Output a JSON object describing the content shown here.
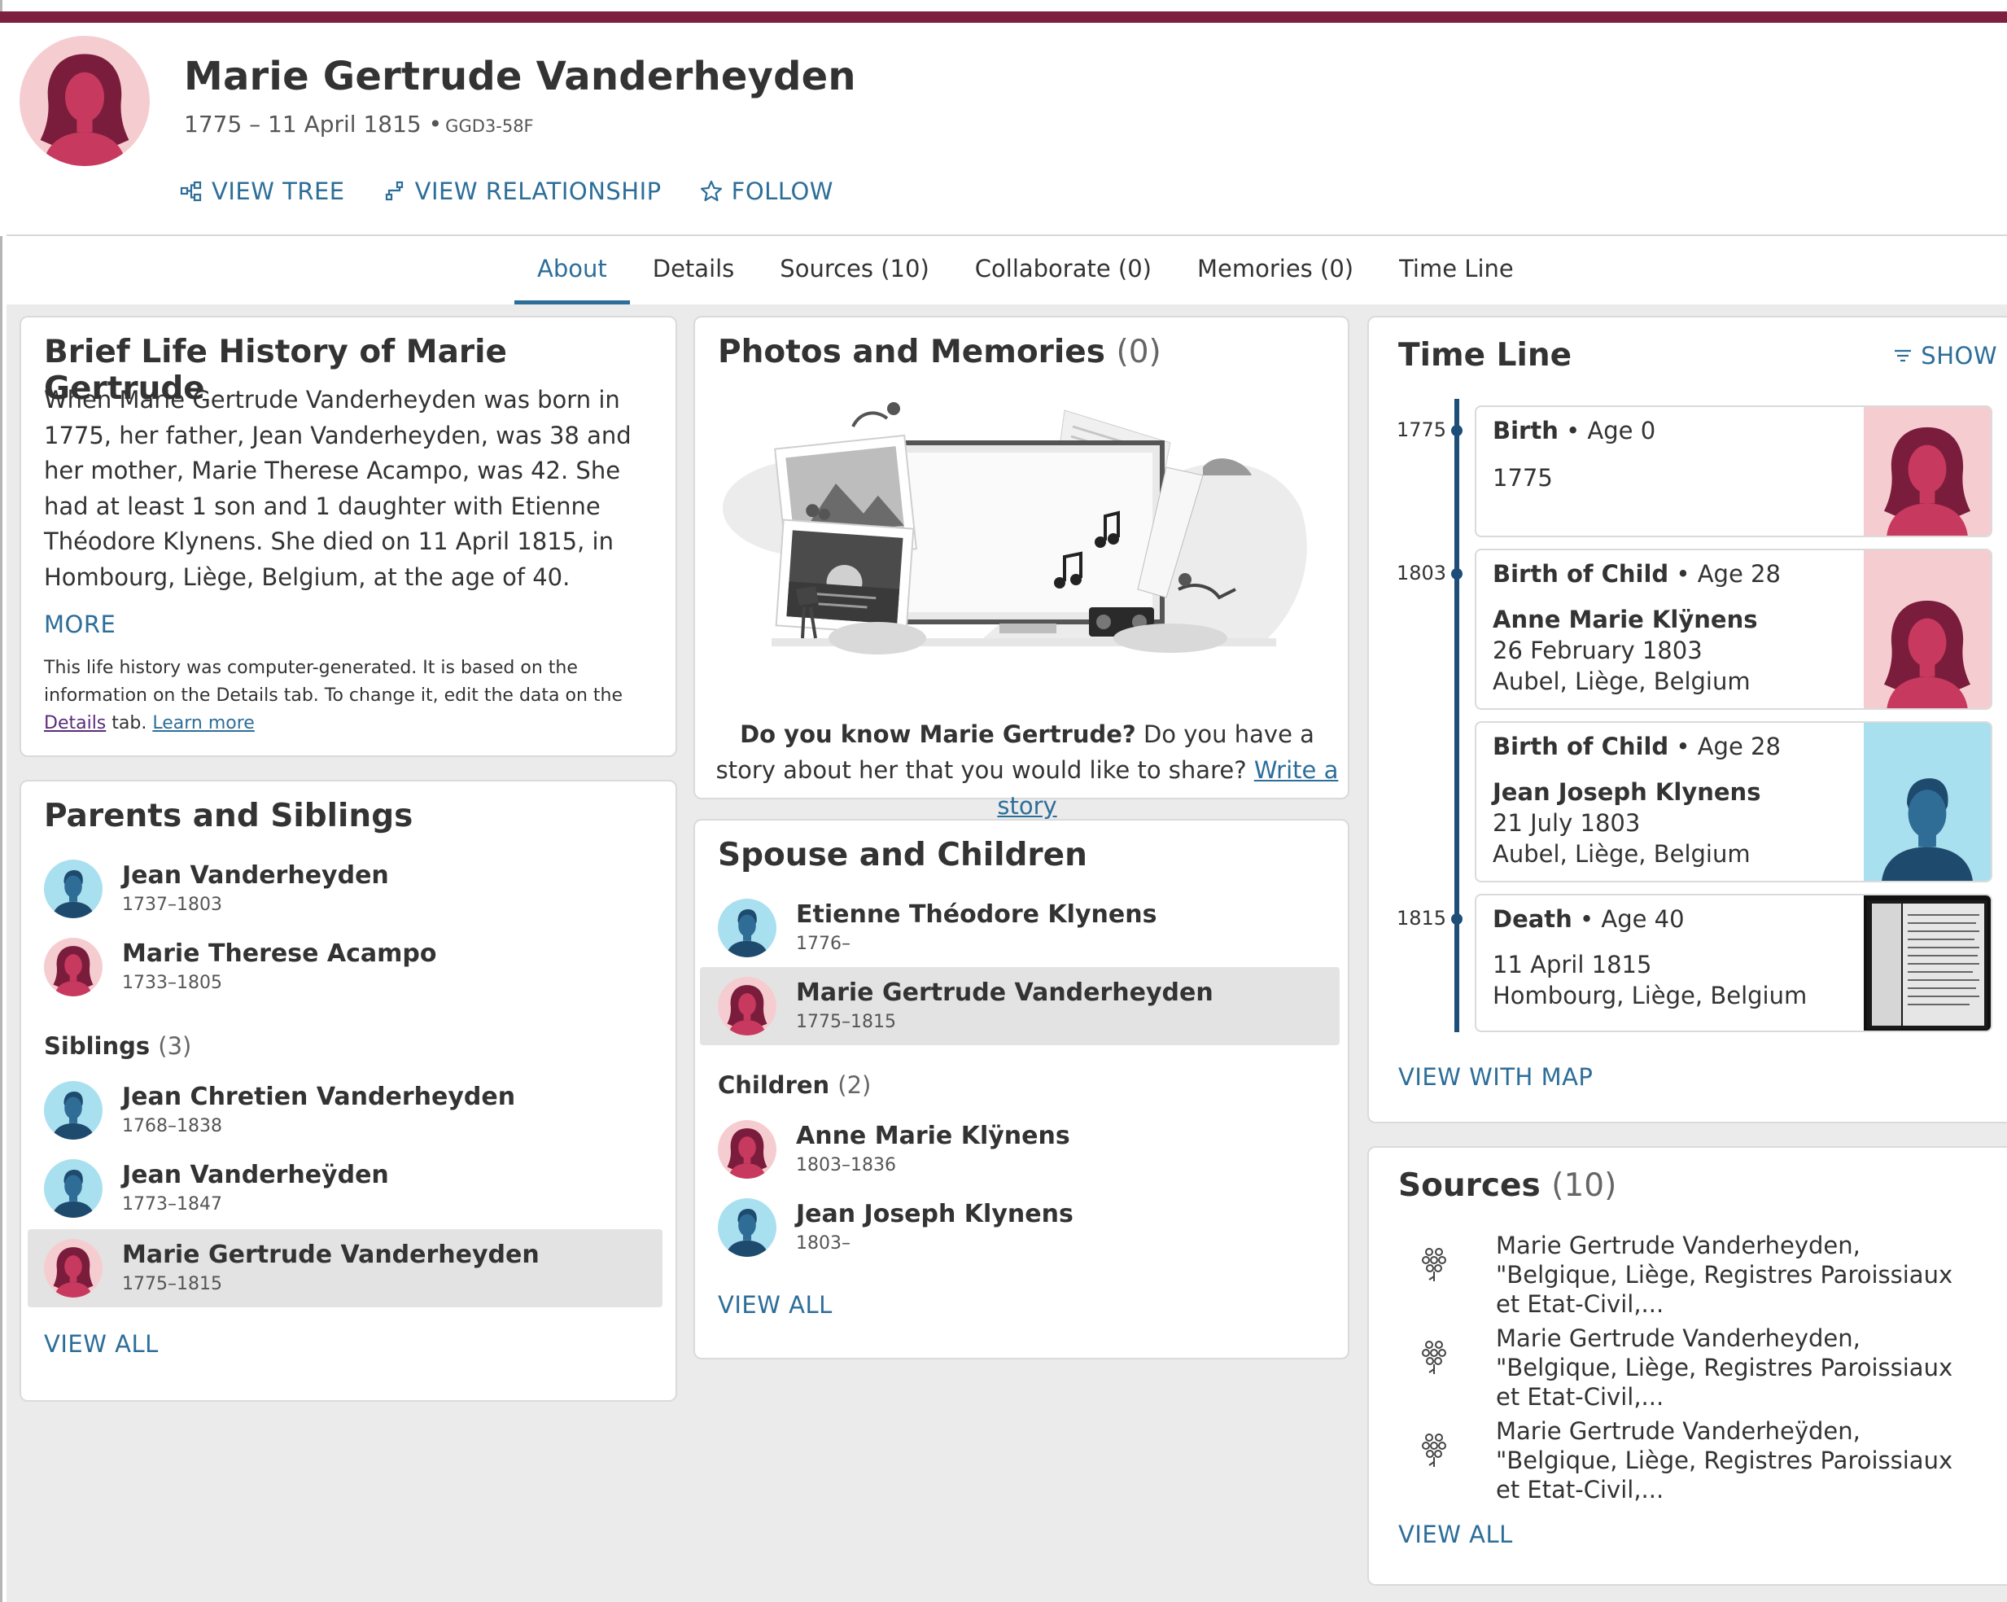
{
  "person": {
    "name": "Marie Gertrude Vanderheyden",
    "lifespan": "1775 – 11 April 1815",
    "id_separator": "•",
    "pid": "GGD3-58F"
  },
  "actions": {
    "view_tree": "VIEW TREE",
    "view_relationship": "VIEW RELATIONSHIP",
    "follow": "FOLLOW"
  },
  "tabs": [
    {
      "label": "About"
    },
    {
      "label": "Details"
    },
    {
      "label": "Sources (10)"
    },
    {
      "label": "Collaborate (0)"
    },
    {
      "label": "Memories (0)"
    },
    {
      "label": "Time Line"
    }
  ],
  "bio": {
    "title": "Brief Life History of Marie Gertrude",
    "text": "When Marie Gertrude Vanderheyden was born in 1775, her father, Jean Vanderheyden, was 38 and her mother, Marie Therese Acampo, was 42. She had at least 1 son and 1 daughter with Etienne Théodore Klynens. She died on 11 April 1815, in Hombourg, Liège, Belgium, at the age of 40.",
    "more": "MORE",
    "note_before": "This life history was computer-generated. It is based on the information on the Details tab. To change it, edit the data on the ",
    "note_link": "Details",
    "note_after": " tab. ",
    "learn_more": "Learn more"
  },
  "parents": {
    "title": "Parents and Siblings",
    "people": [
      {
        "name": "Jean Vanderheyden",
        "dates": "1737–1803"
      },
      {
        "name": "Marie Therese Acampo",
        "dates": "1733–1805"
      }
    ],
    "siblings_label": "Siblings",
    "siblings_count": "(3)",
    "siblings": [
      {
        "name": "Jean Chretien Vanderheyden",
        "dates": "1768–1838"
      },
      {
        "name": "Jean Vanderheÿden",
        "dates": "1773–1847"
      },
      {
        "name": "Marie Gertrude Vanderheyden",
        "dates": "1775–1815"
      }
    ],
    "view_all": "VIEW ALL"
  },
  "photos": {
    "title": "Photos and Memories",
    "count": "(0)",
    "question_bold": "Do you know Marie Gertrude?",
    "question_rest": " Do you have a story about her that you would like to share? ",
    "write_link": "Write a story"
  },
  "spouse": {
    "title": "Spouse and Children",
    "people": [
      {
        "name": "Etienne Théodore Klynens",
        "dates": "1776–"
      },
      {
        "name": "Marie Gertrude Vanderheyden",
        "dates": "1775–1815"
      }
    ],
    "children_label": "Children",
    "children_count": "(2)",
    "children": [
      {
        "name": "Anne Marie Klÿnens",
        "dates": "1803–1836"
      },
      {
        "name": "Jean Joseph Klynens",
        "dates": "1803–"
      }
    ],
    "view_all": "VIEW ALL"
  },
  "timeline": {
    "title": "Time Line",
    "show": "SHOW",
    "events": [
      {
        "year": "1775",
        "event": "Birth",
        "age": "Age 0",
        "line1": "1775",
        "line2": "",
        "line3": ""
      },
      {
        "year": "1803",
        "event": "Birth of Child",
        "age": "Age 28",
        "line1": "Anne Marie Klÿnens",
        "line2": "26 February 1803",
        "line3": "Aubel, Liège, Belgium"
      },
      {
        "year": "",
        "event": "Birth of Child",
        "age": "Age 28",
        "line1": "Jean Joseph Klynens",
        "line2": "21 July 1803",
        "line3": "Aubel, Liège, Belgium"
      },
      {
        "year": "1815",
        "event": "Death",
        "age": "Age 40",
        "line1": "11 April 1815",
        "line2": "Hombourg, Liège, Belgium",
        "line3": ""
      }
    ],
    "view_with_map": "VIEW WITH MAP"
  },
  "sources": {
    "title": "Sources",
    "count": "(10)",
    "items": [
      {
        "title": "Marie Gertrude Vanderheyden, \"Belgique, Liège, Registres Paroissiaux et Etat-Civil,..."
      },
      {
        "title": "Marie Gertrude Vanderheyden, \"Belgique, Liège, Registres Paroissiaux et Etat-Civil,..."
      },
      {
        "title": "Marie Gertrude Vanderheÿden, \"Belgique, Liège, Registres Paroissiaux et Etat-Civil,..."
      }
    ],
    "view_all": "VIEW ALL"
  },
  "colors": {
    "accent": "#2d6e99",
    "brand_bar": "#7d1f3f",
    "female_bg": "#f5cdd1",
    "male_bg": "#a9e0ef",
    "timeline": "#1e4e78"
  },
  "icons": [
    "tree-icon",
    "relationship-icon",
    "star-icon",
    "filter-icon",
    "source-tree-icon"
  ]
}
